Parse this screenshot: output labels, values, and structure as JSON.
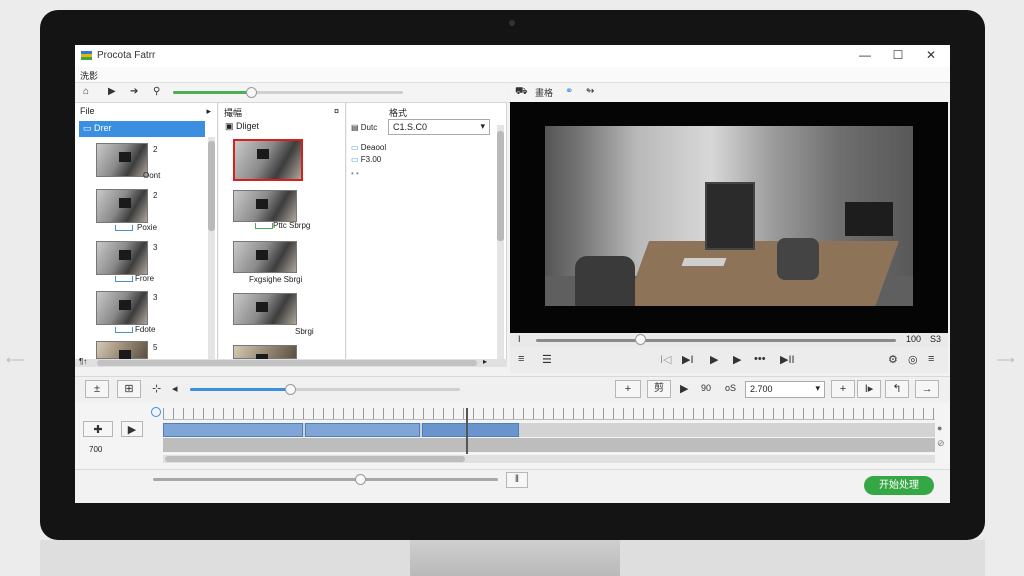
{
  "window": {
    "title": "Procota Fatrr",
    "minimize": "—",
    "maximize": "☐",
    "close": "✕"
  },
  "menu": {
    "label": "洗影"
  },
  "colors": {
    "accent_blue": "#3b8fe0",
    "accent_green": "#35a845",
    "selection_red": "#d62020"
  },
  "toolbar": {
    "icons": [
      "home-icon",
      "play-icon",
      "forward-icon",
      "zoom-icon"
    ],
    "zoom_level": 0.34
  },
  "file_panel": {
    "header": "File",
    "header_arrow": "▸",
    "selected": "Drer",
    "items": [
      {
        "num": "2",
        "label": "Oont"
      },
      {
        "num": "2",
        "label": "Poxie"
      },
      {
        "num": "3",
        "label": "Frore"
      },
      {
        "num": "3",
        "label": "Fdote"
      },
      {
        "num": "5",
        "label": ""
      }
    ],
    "footer": "¶↑"
  },
  "media_panel": {
    "header": "撮幅",
    "header_icon": "¤",
    "folder_label": "Dliget",
    "items": [
      {
        "label": ""
      },
      {
        "label": "Pttc Sbrpg"
      },
      {
        "label": "Fxgsighe Sbrgi"
      },
      {
        "label": "Sbrgi"
      },
      {
        "label": ""
      }
    ]
  },
  "properties_panel": {
    "title": "格式",
    "label": "Dutc",
    "value": "C1.S.C0",
    "rows": [
      "Deaool",
      "F3.00"
    ],
    "dots": "• •"
  },
  "preview_toolbar": {
    "labels": [
      "畫格"
    ]
  },
  "player": {
    "time_left": "I",
    "time_right": "100",
    "end_label": "S3",
    "progress": 0.29
  },
  "transport": {
    "left_icons": [
      "≡",
      "☰"
    ],
    "controls": [
      "I◁",
      "▶I",
      "▶",
      "▶",
      "•••",
      "▶II"
    ],
    "right_icons": [
      "⚙",
      "◎",
      "≡"
    ]
  },
  "edit_bar": {
    "left_buttons": [
      "±",
      "⊞",
      "⊹",
      "◂"
    ],
    "zoom": 0.37,
    "cut_label": "剪",
    "rate_label": "90",
    "speed_label": "oS",
    "value": "2.700",
    "right_buttons": [
      "+",
      "I▸",
      "↰",
      "→"
    ]
  },
  "timeline": {
    "left_controls": [
      "✚",
      "▶"
    ],
    "time_label": "700",
    "rulerMarks": 0
  },
  "bottom": {
    "volume": 0.6,
    "pause_label": "‖",
    "start_label": "开始处理"
  }
}
